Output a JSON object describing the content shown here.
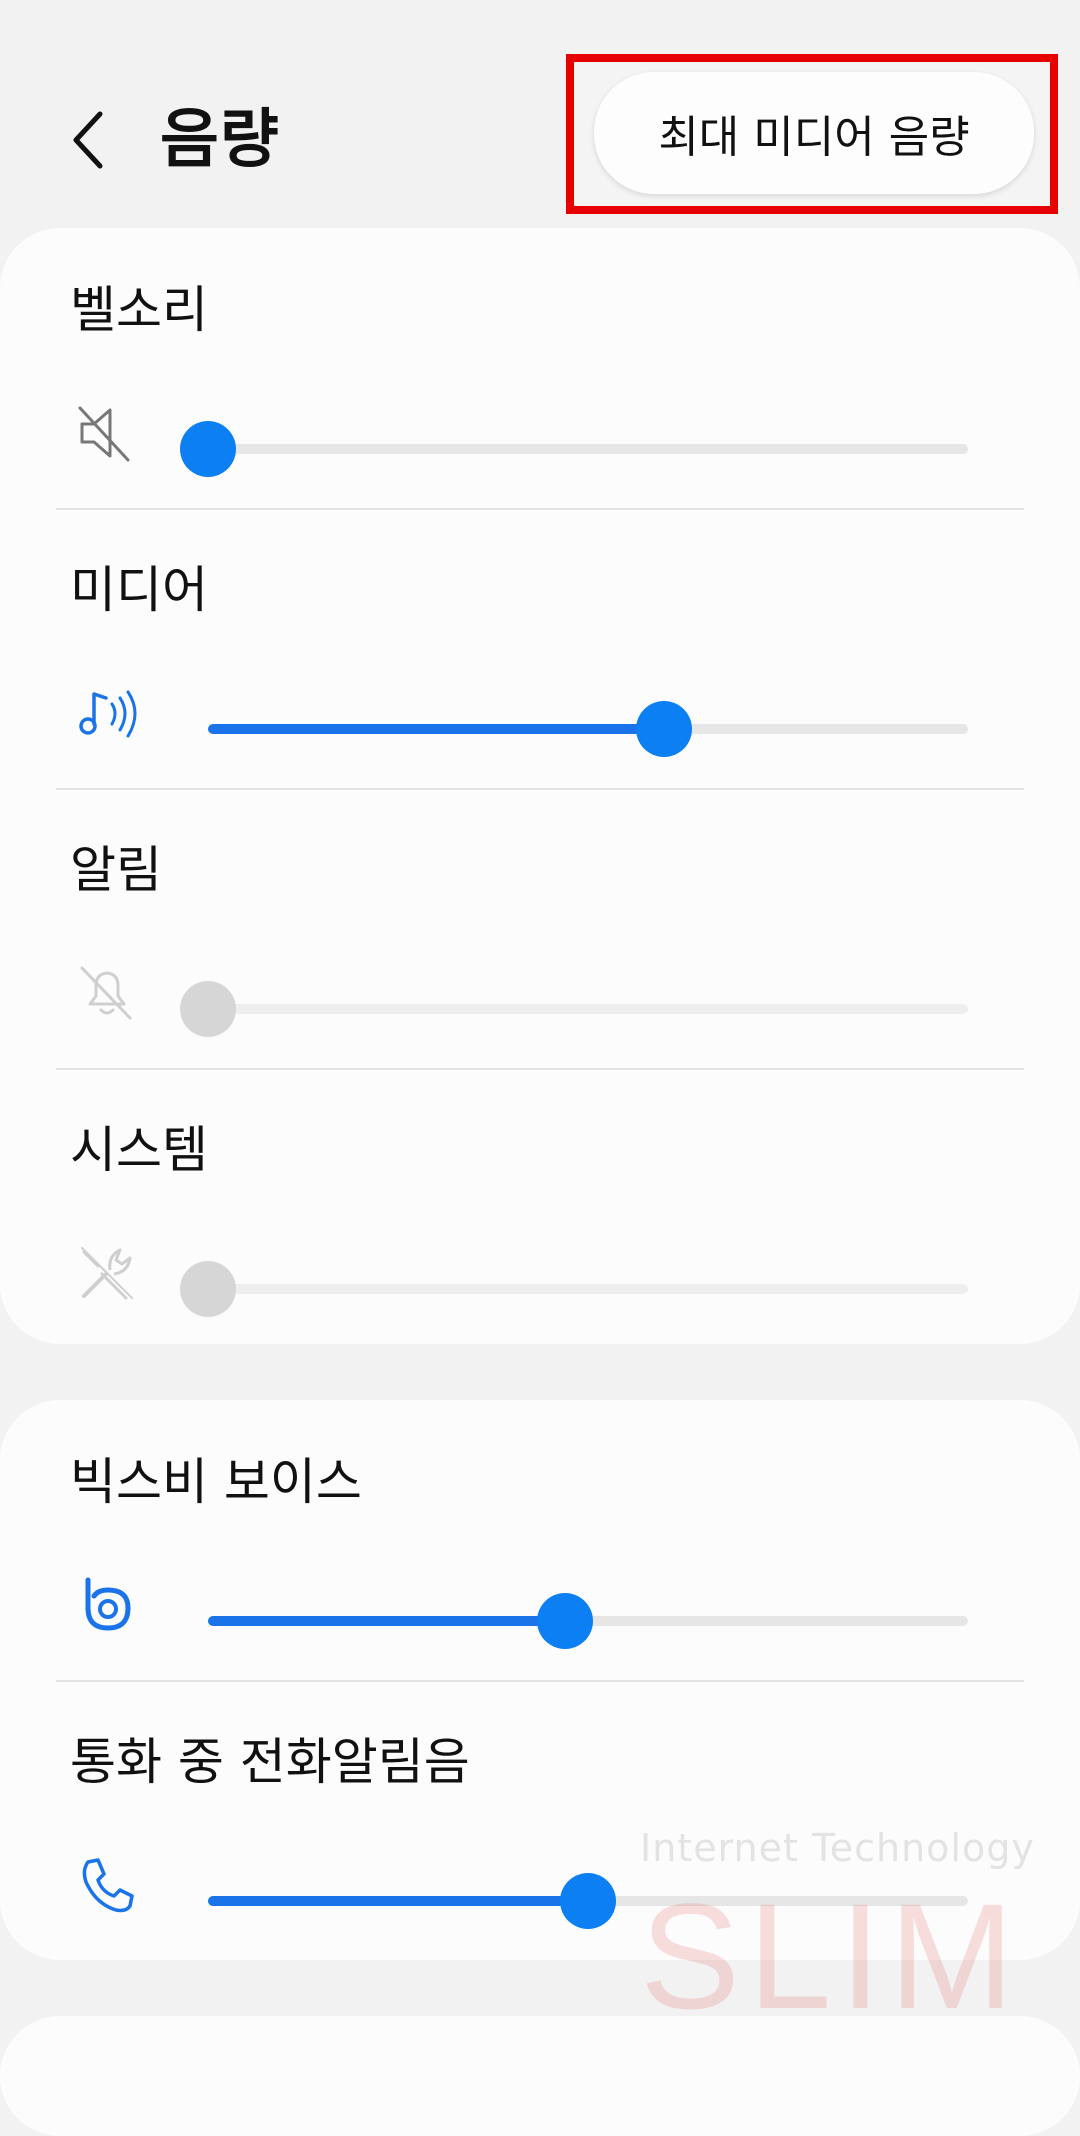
{
  "header": {
    "title": "음량",
    "max_media_button": "최대 미디어 음량"
  },
  "volume_rows": [
    {
      "label": "벨소리",
      "icon": "mute-speaker-icon",
      "level": 0.0,
      "enabled": true
    },
    {
      "label": "미디어",
      "icon": "music-note-icon",
      "level": 0.6,
      "enabled": true
    },
    {
      "label": "알림",
      "icon": "notification-bell-off-icon",
      "level": 0.0,
      "enabled": false
    },
    {
      "label": "시스템",
      "icon": "system-tools-icon",
      "level": 0.0,
      "enabled": false
    }
  ],
  "secondary_rows": [
    {
      "label": "빅스비 보이스",
      "icon": "bixby-icon",
      "level": 0.47,
      "enabled": true
    },
    {
      "label": "통화 중 전화알림음",
      "icon": "phone-icon",
      "level": 0.5,
      "enabled": true
    }
  ],
  "watermark": {
    "line1": "Internet Technology",
    "line2": "SLIM"
  },
  "colors": {
    "accent": "#0c7ff2",
    "highlight_border": "#e60000"
  }
}
